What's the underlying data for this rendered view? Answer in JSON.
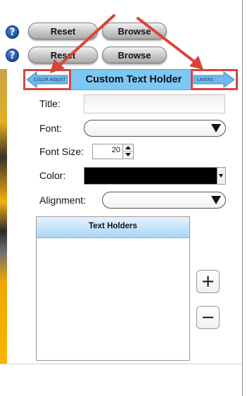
{
  "toolbar_rows": [
    {
      "help": "?",
      "reset_label": "Reset",
      "browse_label": "Browse"
    },
    {
      "help": "?",
      "reset_label": "Reset",
      "browse_label": "Browse"
    }
  ],
  "header": {
    "title": "Custom Text Holder",
    "left_arrow_label": "COLOR ADJUST",
    "right_arrow_label": "LAYERS"
  },
  "form": {
    "title_label": "Title:",
    "title_value": "",
    "font_label": "Font:",
    "font_value": "",
    "font_size_label": "Font Size:",
    "font_size_value": "20",
    "color_label": "Color:",
    "color_value": "#000000",
    "alignment_label": "Alignment:",
    "alignment_value": ""
  },
  "text_holders": {
    "header": "Text Holders",
    "items": [],
    "add_symbol": "+",
    "remove_symbol": "−"
  },
  "annotation_color": "#d9443a",
  "header_bar_color": "#7cc8f4"
}
